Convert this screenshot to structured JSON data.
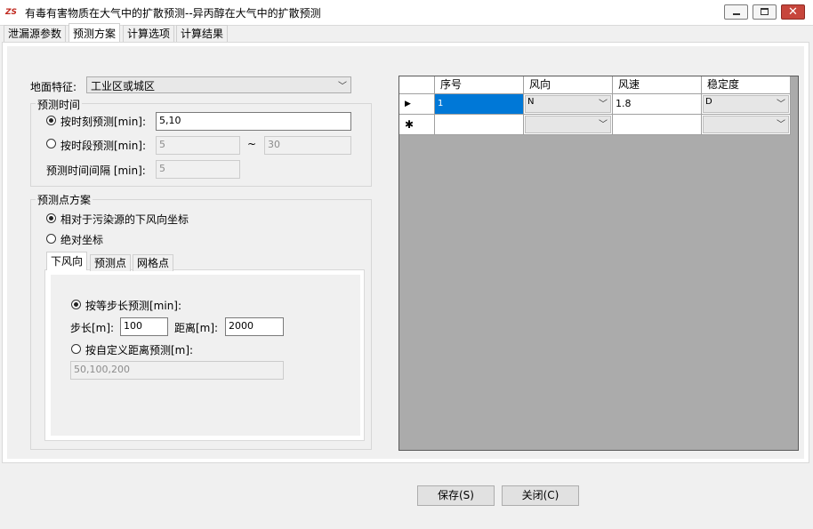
{
  "window": {
    "title": "有毒有害物质在大气中的扩散预测--异丙醇在大气中的扩散预测",
    "app_icon_text": "ZS",
    "close_glyph": "✕"
  },
  "tabs": [
    {
      "label": "泄漏源参数"
    },
    {
      "label": "预测方案"
    },
    {
      "label": "计算选项"
    },
    {
      "label": "计算结果"
    }
  ],
  "ground": {
    "label": "地面特征:",
    "value": "工业区或城区"
  },
  "predict_time": {
    "group_title": "预测时间",
    "by_moment_label": "按时刻预测[min]:",
    "by_moment_value": "5,10",
    "by_period_label": "按时段预测[min]:",
    "period_from": "5",
    "tilde": "~",
    "period_to": "30",
    "interval_label": "预测时间间隔 [min]:",
    "interval_value": "5"
  },
  "point_scheme": {
    "group_title": "预测点方案",
    "option_relative": "相对于污染源的下风向坐标",
    "option_absolute": "绝对坐标",
    "subtabs": [
      {
        "label": "下风向"
      },
      {
        "label": "预测点"
      },
      {
        "label": "网格点"
      }
    ],
    "equal_step_label": "按等步长预测[min]:",
    "step_label": "步长[m]:",
    "step_value": "100",
    "distance_label": "距离[m]:",
    "distance_value": "2000",
    "custom_label": "按自定义距离预测[m]:",
    "custom_value": "50,100,200"
  },
  "grid": {
    "columns": [
      "序号",
      "风向",
      "风速",
      "稳定度"
    ],
    "rows": [
      {
        "marker": "▶",
        "index": "1",
        "direction": "N",
        "speed": "1.8",
        "stability": "D"
      },
      {
        "marker": "✱",
        "index": "",
        "direction": "",
        "speed": "",
        "stability": ""
      }
    ]
  },
  "buttons": {
    "save": "保存(S)",
    "close": "关闭(C)"
  },
  "colors": {
    "selected_cell": "#0078d7",
    "grid_background": "#ababab",
    "close_button": "#c7463c"
  }
}
